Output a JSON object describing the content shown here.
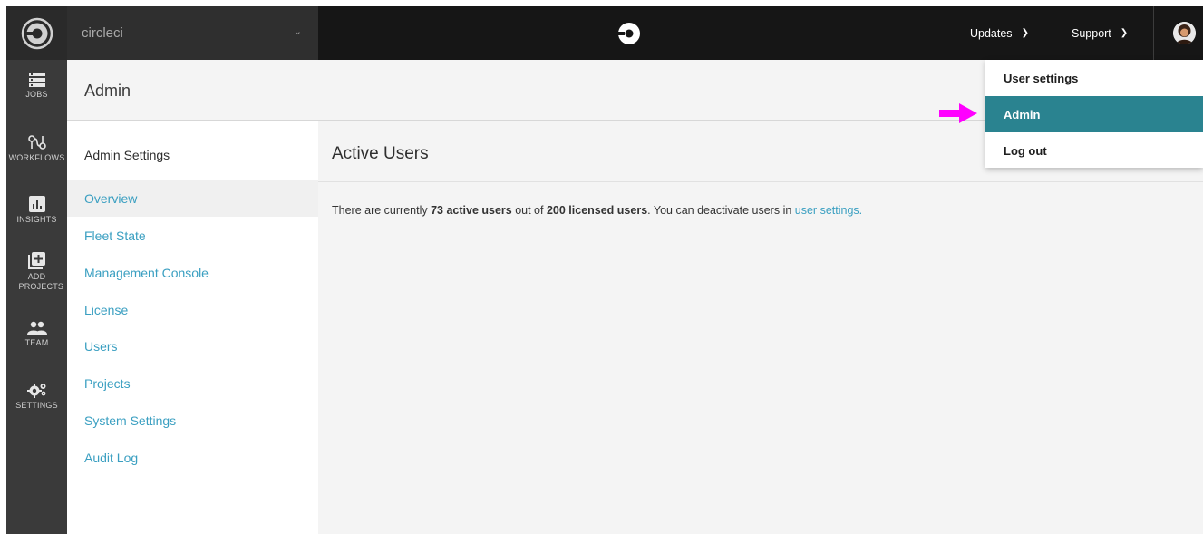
{
  "topbar": {
    "org_name": "circleci",
    "updates_label": "Updates",
    "support_label": "Support"
  },
  "rail": {
    "items": [
      {
        "label": "JOBS",
        "icon": "jobs-icon"
      },
      {
        "label": "WORKFLOWS",
        "icon": "workflows-icon"
      },
      {
        "label": "INSIGHTS",
        "icon": "insights-icon"
      },
      {
        "label": "ADD PROJECTS",
        "icon": "add-projects-icon"
      },
      {
        "label": "TEAM",
        "icon": "team-icon"
      },
      {
        "label": "SETTINGS",
        "icon": "settings-icon"
      }
    ]
  },
  "admin_header": {
    "title": "Admin"
  },
  "settings_nav": {
    "title": "Admin Settings",
    "items": [
      {
        "label": "Overview",
        "active": true
      },
      {
        "label": "Fleet State"
      },
      {
        "label": "Management Console"
      },
      {
        "label": "License"
      },
      {
        "label": "Users"
      },
      {
        "label": "Projects"
      },
      {
        "label": "System Settings"
      },
      {
        "label": "Audit Log"
      }
    ]
  },
  "main": {
    "title": "Active Users",
    "summary": {
      "prefix": "There are currently ",
      "active_users": "73 active users",
      "middle": " out of ",
      "licensed_users": "200 licensed users",
      "suffix": ". You can deactivate users in ",
      "link": "user settings."
    }
  },
  "user_dropdown": {
    "items": [
      {
        "label": "User settings"
      },
      {
        "label": "Admin",
        "active": true
      },
      {
        "label": "Log out"
      }
    ]
  },
  "colors": {
    "topbar": "#161616",
    "rail": "#3a3a3a",
    "link": "#3a9fc1",
    "dropdown_active": "#2a8390",
    "pointer_arrow": "#ff00ff"
  }
}
